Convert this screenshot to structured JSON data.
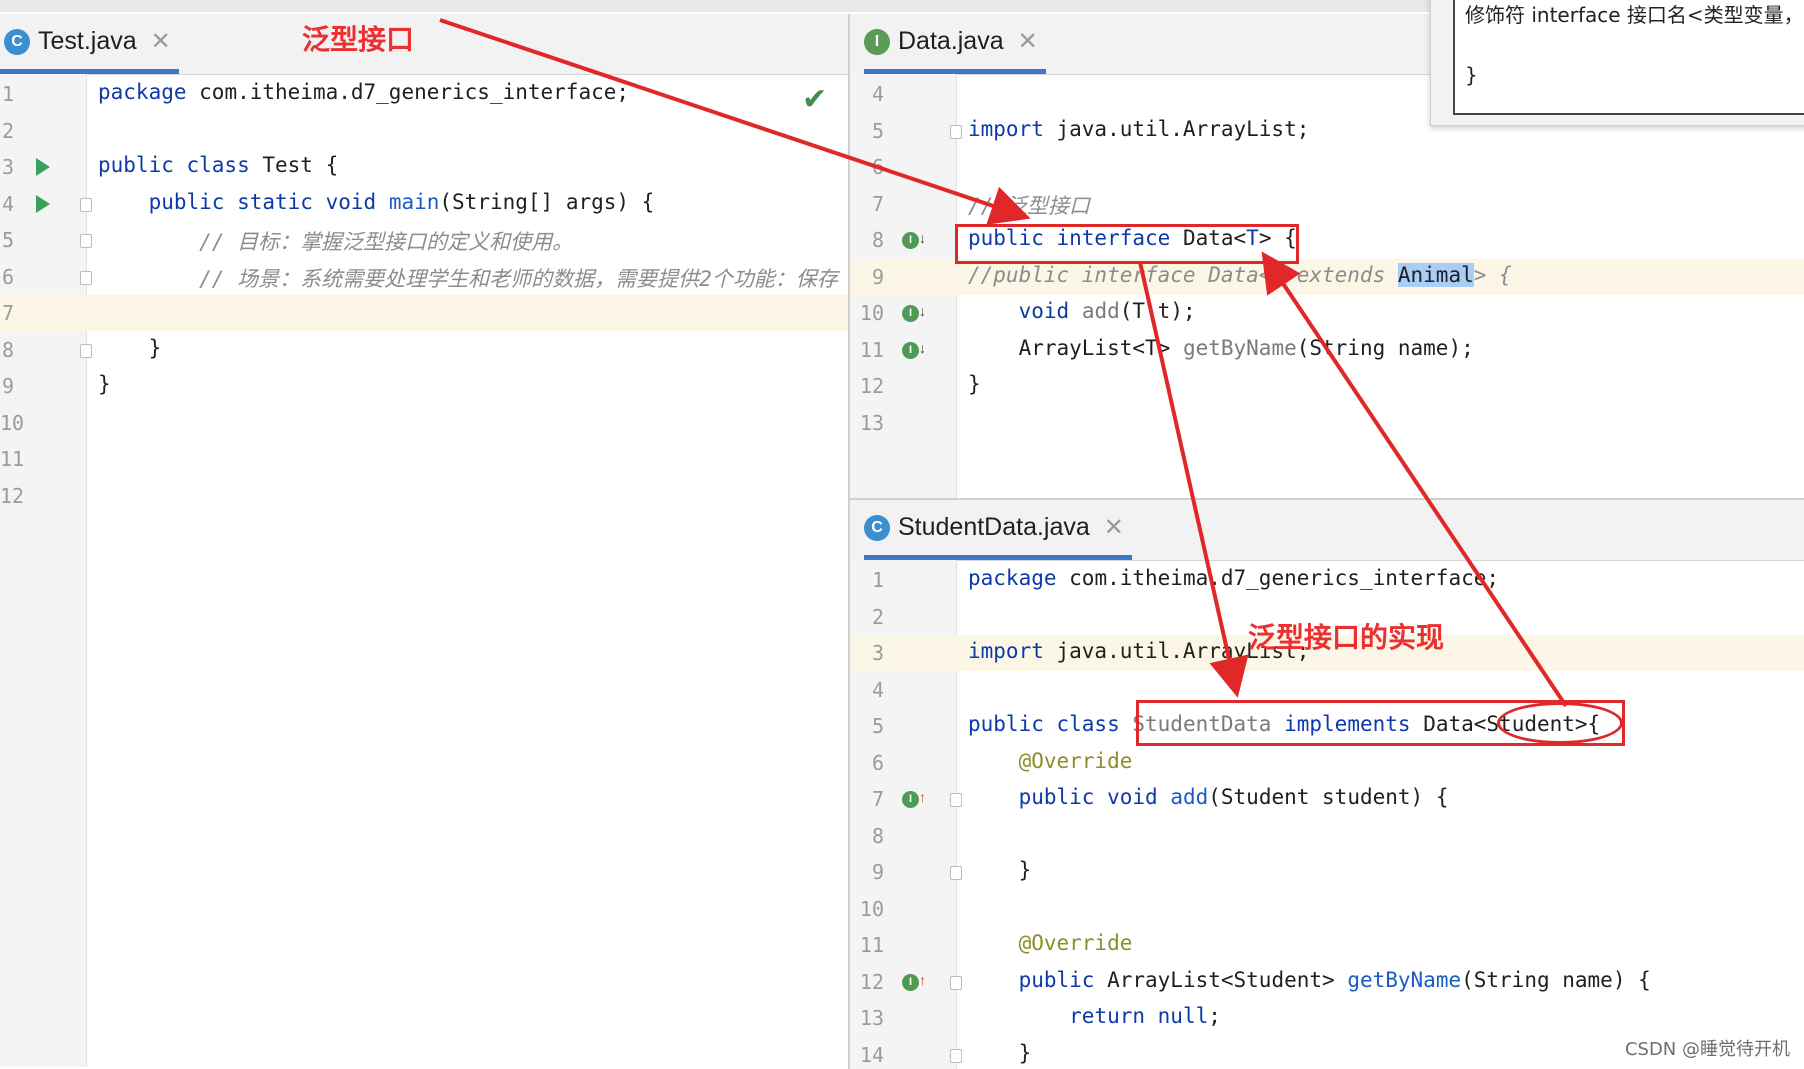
{
  "left_pane": {
    "tab": {
      "label": "Test.java",
      "icon": "class-icon",
      "icon_letter": "C"
    },
    "lines": [
      {
        "num": "1",
        "code": [
          [
            "kw",
            "package"
          ],
          [
            "t",
            " com.itheima.d7_generics_interface;"
          ]
        ]
      },
      {
        "num": "2",
        "code": []
      },
      {
        "num": "3",
        "code": [
          [
            "kw",
            "public class"
          ],
          [
            "t",
            " Test {"
          ]
        ],
        "run": true
      },
      {
        "num": "4",
        "code": [
          [
            "t",
            "    "
          ],
          [
            "kw",
            "public static void"
          ],
          [
            "t",
            " "
          ],
          [
            "fn",
            "main"
          ],
          [
            "t",
            "(String[] args) {"
          ]
        ],
        "run": true,
        "fold": true
      },
      {
        "num": "5",
        "code": [
          [
            "cm",
            "        // 目标：掌握泛型接口的定义和使用。"
          ]
        ],
        "fold": true
      },
      {
        "num": "6",
        "code": [
          [
            "cm",
            "        // 场景：系统需要处理学生和老师的数据，需要提供2个功能：保存"
          ]
        ],
        "fold": true
      },
      {
        "num": "7",
        "code": [],
        "highlight": true
      },
      {
        "num": "8",
        "code": [
          [
            "t",
            "    }"
          ]
        ],
        "fold": true
      },
      {
        "num": "9",
        "code": [
          [
            "t",
            "}"
          ]
        ]
      },
      {
        "num": "10",
        "code": []
      },
      {
        "num": "11",
        "code": []
      },
      {
        "num": "12",
        "code": []
      }
    ]
  },
  "top_right_pane": {
    "tab": {
      "label": "Data.java",
      "icon": "interface-icon",
      "icon_letter": "I"
    },
    "lines": [
      {
        "num": "4",
        "code": []
      },
      {
        "num": "5",
        "code": [
          [
            "kw",
            "import"
          ],
          [
            "t",
            " java.util.ArrayList;"
          ]
        ],
        "fold": true
      },
      {
        "num": "6",
        "code": []
      },
      {
        "num": "7",
        "code": [
          [
            "cm",
            "// 泛型接口"
          ]
        ]
      },
      {
        "num": "8",
        "code": [
          [
            "kw",
            "public interface"
          ],
          [
            "t",
            " Data<"
          ],
          [
            "kw",
            "T"
          ],
          [
            "t",
            "> {"
          ]
        ],
        "gutter_mark": "↓"
      },
      {
        "num": "9",
        "code": [
          [
            "cm",
            "//public interface Data<T extends "
          ],
          [
            "sel",
            "Animal"
          ],
          [
            "cm",
            "> {"
          ]
        ],
        "highlight": true
      },
      {
        "num": "10",
        "code": [
          [
            "t",
            "    "
          ],
          [
            "kw",
            "void"
          ],
          [
            "t",
            " "
          ],
          [
            "gr",
            "add"
          ],
          [
            "t",
            "(T t);"
          ]
        ],
        "gutter_mark": "↓"
      },
      {
        "num": "11",
        "code": [
          [
            "t",
            "    ArrayList<T> "
          ],
          [
            "gr",
            "getByName"
          ],
          [
            "t",
            "(String name);"
          ]
        ],
        "gutter_mark": "↓"
      },
      {
        "num": "12",
        "code": [
          [
            "t",
            "}"
          ]
        ]
      },
      {
        "num": "13",
        "code": []
      }
    ]
  },
  "bottom_right_pane": {
    "tab": {
      "label": "StudentData.java",
      "icon": "class-icon",
      "icon_letter": "C"
    },
    "lines": [
      {
        "num": "1",
        "code": [
          [
            "kw",
            "package"
          ],
          [
            "t",
            " com.itheima.d7_generics_interface;"
          ]
        ]
      },
      {
        "num": "2",
        "code": []
      },
      {
        "num": "3",
        "code": [
          [
            "kw",
            "import"
          ],
          [
            "t",
            " java.util.ArrayList;"
          ]
        ],
        "highlight": true
      },
      {
        "num": "4",
        "code": []
      },
      {
        "num": "5",
        "code": [
          [
            "kw",
            "public class"
          ],
          [
            "t",
            " "
          ],
          [
            "gr",
            "StudentData"
          ],
          [
            "t",
            " "
          ],
          [
            "kw",
            "implements"
          ],
          [
            "t",
            " Data<Student>{"
          ]
        ]
      },
      {
        "num": "6",
        "code": [
          [
            "an",
            "    @Override"
          ]
        ]
      },
      {
        "num": "7",
        "code": [
          [
            "t",
            "    "
          ],
          [
            "kw",
            "public void"
          ],
          [
            "t",
            " "
          ],
          [
            "fn",
            "add"
          ],
          [
            "t",
            "(Student student) {"
          ]
        ],
        "gutter_mark": "↑",
        "fold": true
      },
      {
        "num": "8",
        "code": []
      },
      {
        "num": "9",
        "code": [
          [
            "t",
            "    }"
          ]
        ],
        "fold": true
      },
      {
        "num": "10",
        "code": []
      },
      {
        "num": "11",
        "code": [
          [
            "an",
            "    @Override"
          ]
        ]
      },
      {
        "num": "12",
        "code": [
          [
            "t",
            "    "
          ],
          [
            "kw",
            "public"
          ],
          [
            "t",
            " ArrayList<Student> "
          ],
          [
            "fn",
            "getByName"
          ],
          [
            "t",
            "(String name) {"
          ]
        ],
        "gutter_mark": "↑",
        "fold": true
      },
      {
        "num": "13",
        "code": [
          [
            "t",
            "        "
          ],
          [
            "kw",
            "return null"
          ],
          [
            "t",
            ";"
          ]
        ]
      },
      {
        "num": "14",
        "code": [
          [
            "t",
            "    }"
          ]
        ],
        "fold": true
      }
    ]
  },
  "annotations": {
    "generic_interface": "泛型接口",
    "generic_interface_impl": "泛型接口的实现"
  },
  "popup": {
    "line1": "修饰符 interface 接口名<类型变量，类",
    "line2": "}"
  },
  "watermark": "CSDN @睡觉待开机",
  "colors": {
    "keyword": "#0d3aa8",
    "annotation_red": "#e02828",
    "run_green": "#3aa05c",
    "tab_underline": "#3d78c6"
  }
}
